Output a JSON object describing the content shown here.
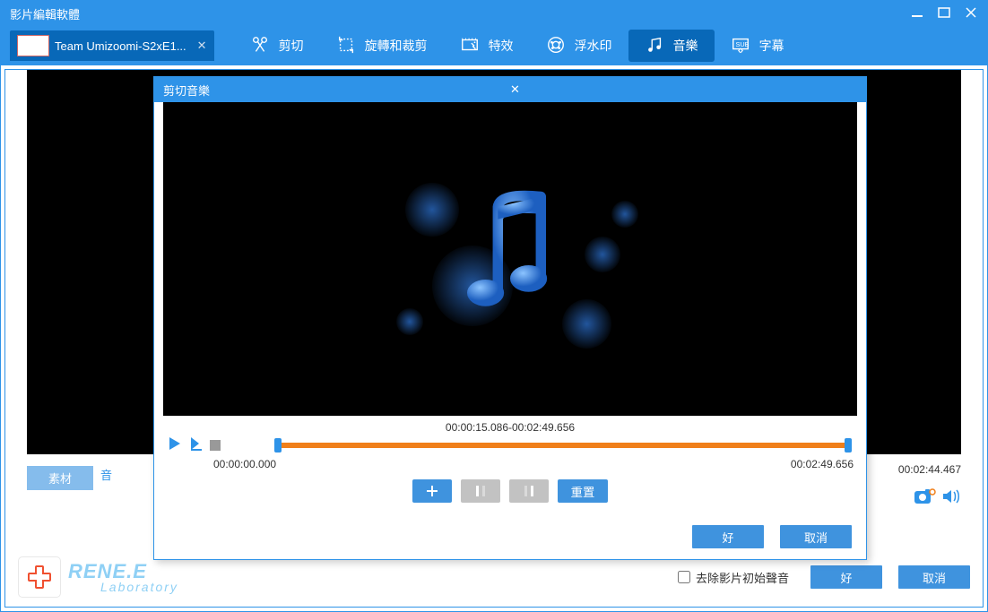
{
  "window": {
    "title": "影片編輯軟體"
  },
  "open_tab": {
    "label": "Team Umizoomi-S2xE1..."
  },
  "toolbar": {
    "cut": "剪切",
    "rotate_crop": "旋轉和裁剪",
    "effects": "特效",
    "watermark": "浮水印",
    "music": "音樂",
    "subtitle": "字幕"
  },
  "side_tab": {
    "material": "素材",
    "music_truncated": "音"
  },
  "main_time": {
    "total": "00:02:44.467"
  },
  "dialog": {
    "title": "剪切音樂",
    "range": "00:00:15.086-00:02:49.656",
    "start_time": "00:00:00.000",
    "end_time": "00:02:49.656",
    "reset": "重置",
    "ok": "好",
    "cancel": "取消"
  },
  "footer": {
    "remove_audio": "去除影片初始聲音",
    "ok": "好",
    "cancel": "取消",
    "logo_line1": "RENE.E",
    "logo_line2": "Laboratory"
  }
}
